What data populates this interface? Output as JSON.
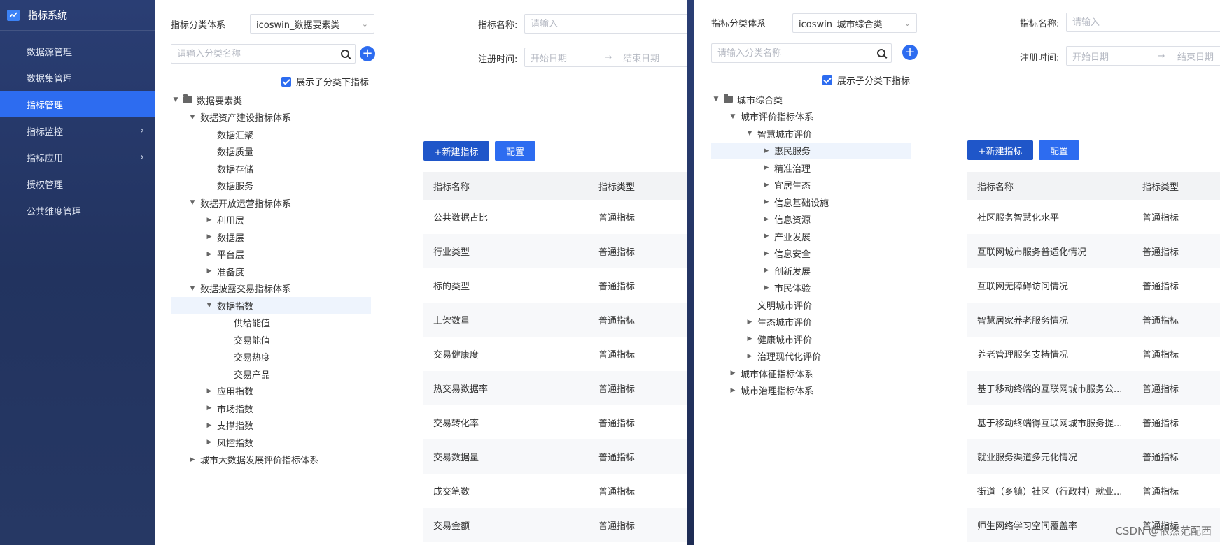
{
  "sidebar": {
    "title": "指标系统",
    "items": [
      {
        "label": "数据源管理",
        "active": false,
        "chevron": false
      },
      {
        "label": "数据集管理",
        "active": false,
        "chevron": false
      },
      {
        "label": "指标管理",
        "active": true,
        "chevron": false
      },
      {
        "label": "指标监控",
        "active": false,
        "chevron": true
      },
      {
        "label": "指标应用",
        "active": false,
        "chevron": true
      },
      {
        "label": "授权管理",
        "active": false,
        "chevron": false
      },
      {
        "label": "公共维度管理",
        "active": false,
        "chevron": false
      }
    ]
  },
  "left": {
    "category_label": "指标分类体系",
    "category_value": "icoswin_数据要素类",
    "search_placeholder": "请输入分类名称",
    "show_children_label": "展示子分类下指标",
    "indicator_name_label": "指标名称:",
    "indicator_name_placeholder": "请输入",
    "reg_time_label": "注册时间:",
    "start_date": "开始日期",
    "end_date": "结束日期",
    "new_button": "+新建指标",
    "config_button": "配置",
    "tree": [
      {
        "label": "数据要素类",
        "level": 0,
        "caret": "down",
        "folder": true
      },
      {
        "label": "数据资产建设指标体系",
        "level": 1,
        "caret": "down"
      },
      {
        "label": "数据汇聚",
        "level": 2,
        "caret": "none"
      },
      {
        "label": "数据质量",
        "level": 2,
        "caret": "none"
      },
      {
        "label": "数据存储",
        "level": 2,
        "caret": "none"
      },
      {
        "label": "数据服务",
        "level": 2,
        "caret": "none"
      },
      {
        "label": "数据开放运营指标体系",
        "level": 1,
        "caret": "down"
      },
      {
        "label": "利用层",
        "level": 2,
        "caret": "right"
      },
      {
        "label": "数据层",
        "level": 2,
        "caret": "right"
      },
      {
        "label": "平台层",
        "level": 2,
        "caret": "right"
      },
      {
        "label": "准备度",
        "level": 2,
        "caret": "right"
      },
      {
        "label": "数据披露交易指标体系",
        "level": 1,
        "caret": "down"
      },
      {
        "label": "数据指数",
        "level": 2,
        "caret": "down",
        "highlight": true
      },
      {
        "label": "供给能值",
        "level": 3,
        "caret": "none"
      },
      {
        "label": "交易能值",
        "level": 3,
        "caret": "none"
      },
      {
        "label": "交易热度",
        "level": 3,
        "caret": "none"
      },
      {
        "label": "交易产品",
        "level": 3,
        "caret": "none"
      },
      {
        "label": "应用指数",
        "level": 2,
        "caret": "right"
      },
      {
        "label": "市场指数",
        "level": 2,
        "caret": "right"
      },
      {
        "label": "支撑指数",
        "level": 2,
        "caret": "right"
      },
      {
        "label": "风控指数",
        "level": 2,
        "caret": "right"
      },
      {
        "label": "城市大数据发展评价指标体系",
        "level": 1,
        "caret": "right"
      }
    ],
    "table": {
      "headers": [
        "指标名称",
        "指标类型"
      ],
      "rows": [
        [
          "公共数据占比",
          "普通指标"
        ],
        [
          "行业类型",
          "普通指标"
        ],
        [
          "标的类型",
          "普通指标"
        ],
        [
          "上架数量",
          "普通指标"
        ],
        [
          "交易健康度",
          "普通指标"
        ],
        [
          "热交易数据率",
          "普通指标"
        ],
        [
          "交易转化率",
          "普通指标"
        ],
        [
          "交易数据量",
          "普通指标"
        ],
        [
          "成交笔数",
          "普通指标"
        ],
        [
          "交易金额",
          "普通指标"
        ]
      ]
    }
  },
  "right": {
    "category_label": "指标分类体系",
    "category_value": "icoswin_城市综合类",
    "search_placeholder": "请输入分类名称",
    "show_children_label": "展示子分类下指标",
    "indicator_name_label": "指标名称:",
    "indicator_name_placeholder": "请输入",
    "reg_time_label": "注册时间:",
    "start_date": "开始日期",
    "end_date": "结束日期",
    "new_button": "+新建指标",
    "config_button": "配置",
    "tree": [
      {
        "label": "城市综合类",
        "level": 0,
        "caret": "down",
        "folder": true
      },
      {
        "label": "城市评价指标体系",
        "level": 1,
        "caret": "down"
      },
      {
        "label": "智慧城市评价",
        "level": 2,
        "caret": "down"
      },
      {
        "label": "惠民服务",
        "level": 3,
        "caret": "right",
        "highlight": true
      },
      {
        "label": "精准治理",
        "level": 3,
        "caret": "right"
      },
      {
        "label": "宜居生态",
        "level": 3,
        "caret": "right"
      },
      {
        "label": "信息基础设施",
        "level": 3,
        "caret": "right"
      },
      {
        "label": "信息资源",
        "level": 3,
        "caret": "right"
      },
      {
        "label": "产业发展",
        "level": 3,
        "caret": "right"
      },
      {
        "label": "信息安全",
        "level": 3,
        "caret": "right"
      },
      {
        "label": "创新发展",
        "level": 3,
        "caret": "right"
      },
      {
        "label": "市民体验",
        "level": 3,
        "caret": "right"
      },
      {
        "label": "文明城市评价",
        "level": 2,
        "caret": "none"
      },
      {
        "label": "生态城市评价",
        "level": 2,
        "caret": "right"
      },
      {
        "label": "健康城市评价",
        "level": 2,
        "caret": "right"
      },
      {
        "label": "治理现代化评价",
        "level": 2,
        "caret": "right"
      },
      {
        "label": "城市体征指标体系",
        "level": 1,
        "caret": "right"
      },
      {
        "label": "城市治理指标体系",
        "level": 1,
        "caret": "right"
      }
    ],
    "table": {
      "headers": [
        "指标名称",
        "指标类型"
      ],
      "rows": [
        [
          "社区服务智慧化水平",
          "普通指标"
        ],
        [
          "互联网城市服务普适化情况",
          "普通指标"
        ],
        [
          "互联网无障碍访问情况",
          "普通指标"
        ],
        [
          "智慧居家养老服务情况",
          "普通指标"
        ],
        [
          "养老管理服务支持情况",
          "普通指标"
        ],
        [
          "基于移动终端的互联网城市服务公...",
          "普通指标"
        ],
        [
          "基于移动终端得互联网城市服务提...",
          "普通指标"
        ],
        [
          "就业服务渠道多元化情况",
          "普通指标"
        ],
        [
          "街道（乡镇）社区（行政村）就业...",
          "普通指标"
        ],
        [
          "师生网络学习空间覆盖率",
          "普通指标"
        ]
      ]
    }
  },
  "watermark": "CSDN @依然范配西"
}
